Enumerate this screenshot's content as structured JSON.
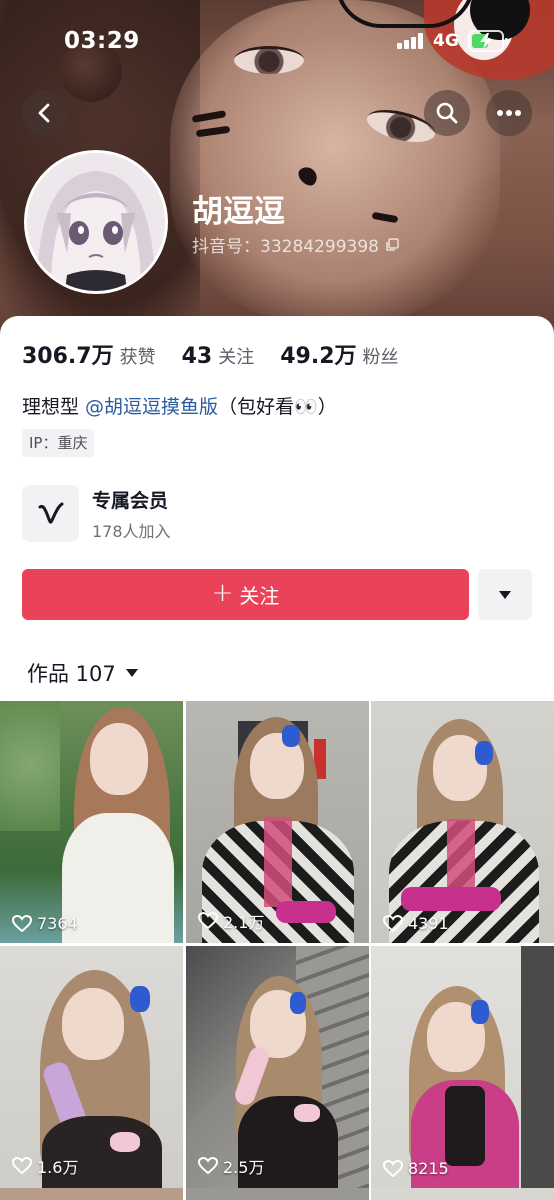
{
  "status_bar": {
    "time": "03:29",
    "network": "4G"
  },
  "profile": {
    "username": "胡逗逗",
    "douyin_id": "抖音号：33284299398"
  },
  "stats": [
    {
      "value": "306.7万",
      "label": "获赞"
    },
    {
      "value": "43",
      "label": "关注"
    },
    {
      "value": "49.2万",
      "label": "粉丝"
    }
  ],
  "bio": {
    "prefix": "理想型 ",
    "mention": "@胡逗逗摸鱼版",
    "suffix": "（包好看👀）"
  },
  "ip_tag": "IP：重庆",
  "membership": {
    "title": "专属会员",
    "subtitle": "178人加入"
  },
  "follow_button": {
    "plus": "+",
    "label": "关注"
  },
  "works_tab": {
    "label": "作品 107"
  },
  "works": [
    {
      "likes": "7364"
    },
    {
      "likes": "2.1万"
    },
    {
      "likes": "4391"
    },
    {
      "likes": "1.6万"
    },
    {
      "likes": "2.5万"
    },
    {
      "likes": "8215"
    }
  ],
  "colors": {
    "accent": "#ea4359",
    "mention": "#2a5aa0",
    "text": "#161823"
  },
  "icons": {
    "back": "chevron-left-icon",
    "search": "search-icon",
    "more": "more-dots-icon",
    "copy": "copy-icon",
    "member": "v-logo-icon",
    "dropdown": "triangle-down-icon",
    "like": "heart-outline-icon"
  }
}
